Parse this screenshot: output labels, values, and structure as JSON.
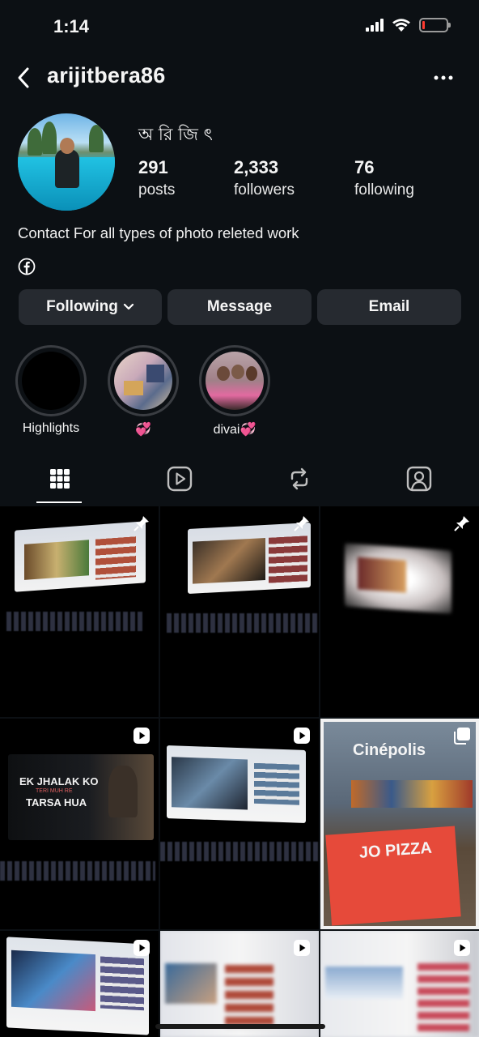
{
  "status_bar": {
    "time": "1:14"
  },
  "header": {
    "username": "arijitbera86"
  },
  "profile": {
    "display_name": "অ রি জি ৎ",
    "stats": [
      {
        "value": "291",
        "label": "posts"
      },
      {
        "value": "2,333",
        "label": "followers"
      },
      {
        "value": "76",
        "label": "following"
      }
    ],
    "bio": "Contact For all types of photo releted work"
  },
  "actions": {
    "following_label": "Following",
    "message_label": "Message",
    "email_label": "Email"
  },
  "highlights": [
    {
      "label": "Highlights"
    },
    {
      "label": "💞"
    },
    {
      "label": "divai💞"
    }
  ],
  "tabs": [
    {
      "icon": "grid-icon",
      "selected": true
    },
    {
      "icon": "reels-icon",
      "selected": false
    },
    {
      "icon": "reposts-icon",
      "selected": false
    },
    {
      "icon": "tagged-icon",
      "selected": false
    }
  ],
  "posts": [
    {
      "badge": "pin-icon"
    },
    {
      "badge": "pin-icon"
    },
    {
      "badge": "pin-icon"
    },
    {
      "badge": "reel-icon",
      "overlay_text": [
        "EK JHALAK KO",
        "TERI MUH RE",
        "TARSA HUA"
      ]
    },
    {
      "badge": "reel-icon"
    },
    {
      "badge": "carousel-icon",
      "overlay_text": [
        "Cinépolis",
        "JO PIZZA"
      ]
    },
    {
      "badge": "reel-icon"
    },
    {
      "badge": "reel-icon"
    },
    {
      "badge": "reel-icon"
    }
  ],
  "colors": {
    "background": "#0c1014",
    "button": "#262a30",
    "text": "#f5f5f5"
  }
}
